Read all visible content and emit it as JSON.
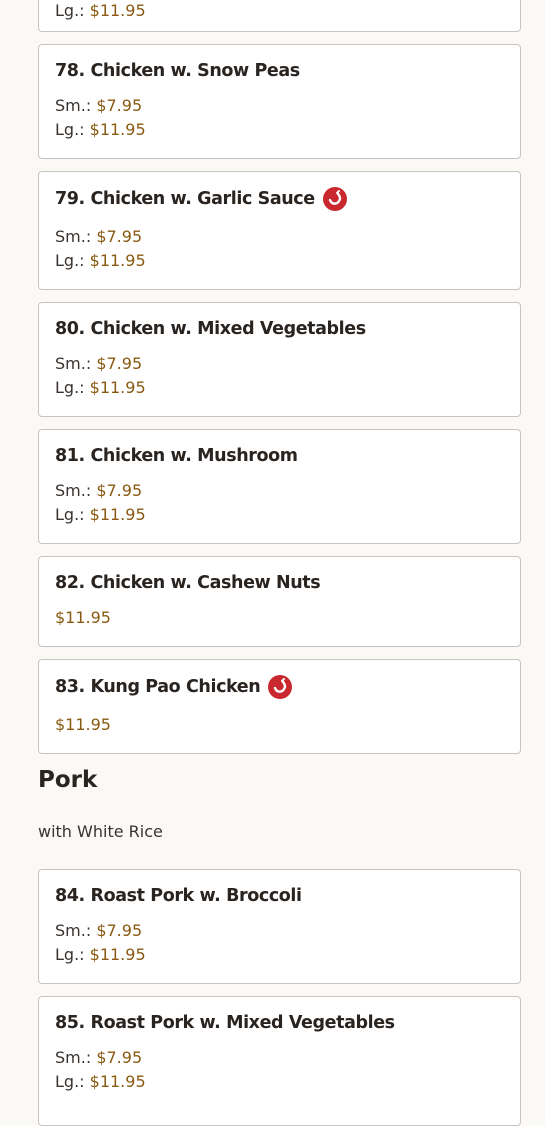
{
  "colors": {
    "price": "#8a5a12",
    "spicy": "#c8282e",
    "border": "#c9c4bf"
  },
  "top_partial": {
    "lg_label": "Lg.:",
    "lg_price": "$11.95"
  },
  "items": [
    {
      "name": "78. Chicken w. Snow Peas",
      "sm_label": "Sm.:",
      "sm_price": "$7.95",
      "lg_label": "Lg.:",
      "lg_price": "$11.95"
    },
    {
      "name": "79. Chicken w. Garlic Sauce",
      "spicy_icon": "chili-pepper-icon",
      "sm_label": "Sm.:",
      "sm_price": "$7.95",
      "lg_label": "Lg.:",
      "lg_price": "$11.95"
    },
    {
      "name": "80. Chicken w. Mixed Vegetables",
      "sm_label": "Sm.:",
      "sm_price": "$7.95",
      "lg_label": "Lg.:",
      "lg_price": "$11.95"
    },
    {
      "name": "81. Chicken w. Mushroom",
      "sm_label": "Sm.:",
      "sm_price": "$7.95",
      "lg_label": "Lg.:",
      "lg_price": "$11.95"
    },
    {
      "name": "82. Chicken w. Cashew Nuts",
      "price": "$11.95"
    },
    {
      "name": "83. Kung Pao Chicken",
      "spicy_icon": "chili-pepper-icon",
      "price": "$11.95"
    }
  ],
  "section": {
    "title": "Pork",
    "subtitle": "with White Rice"
  },
  "pork_items": [
    {
      "name": "84. Roast Pork w. Broccoli",
      "sm_label": "Sm.:",
      "sm_price": "$7.95",
      "lg_label": "Lg.:",
      "lg_price": "$11.95"
    },
    {
      "name": "85. Roast Pork w. Mixed Vegetables",
      "sm_label": "Sm.:",
      "sm_price": "$7.95",
      "lg_label": "Lg.:",
      "lg_price": "$11.95"
    }
  ]
}
